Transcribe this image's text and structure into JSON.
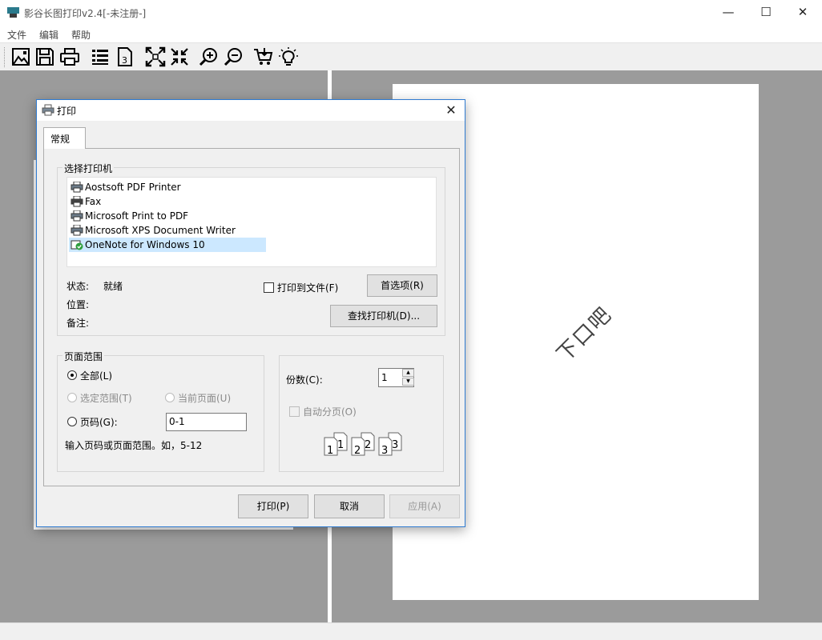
{
  "window": {
    "title": "影谷长图打印v2.4[-未注册-]",
    "controls": {
      "minimize": "—",
      "maximize": "☐",
      "close": "✕"
    }
  },
  "menu": [
    "文件",
    "编辑",
    "帮助"
  ],
  "toolbar": {
    "icons": [
      "open-image-icon",
      "save-icon",
      "print-icon",
      "page-list-icon",
      "page-number-icon",
      "fit-page-icon",
      "actual-size-icon",
      "zoom-in-icon",
      "zoom-out-icon",
      "cart-icon",
      "lightbulb-icon"
    ]
  },
  "preview": {
    "watermark": "下口吧"
  },
  "dialog": {
    "title": "打印",
    "close": "✕",
    "tab": "常规",
    "select_printer": {
      "legend": "选择打印机",
      "printers": [
        {
          "name": "Aostsoft PDF Printer",
          "selected": false
        },
        {
          "name": "Fax",
          "selected": false
        },
        {
          "name": "Microsoft Print to PDF",
          "selected": false
        },
        {
          "name": "Microsoft XPS Document Writer",
          "selected": false
        },
        {
          "name": "OneNote for Windows 10",
          "selected": true
        }
      ],
      "status_label": "状态:",
      "status_value": "就绪",
      "location_label": "位置:",
      "comment_label": "备注:",
      "print_to_file": "打印到文件(F)",
      "preferences": "首选项(R)",
      "find_printer": "查找打印机(D)..."
    },
    "page_range": {
      "legend": "页面范围",
      "all": "全部(L)",
      "selection": "选定范围(T)",
      "current_page": "当前页面(U)",
      "pages": "页码(G):",
      "pages_value": "0-1",
      "hint": "输入页码或页面范围。如，5-12"
    },
    "copies": {
      "label": "份数(C):",
      "value": "1",
      "collate": "自动分页(O)",
      "collate_digits": [
        "1",
        "1",
        "2",
        "2",
        "3",
        "3"
      ]
    },
    "buttons": {
      "print": "打印(P)",
      "cancel": "取消",
      "apply": "应用(A)"
    }
  }
}
